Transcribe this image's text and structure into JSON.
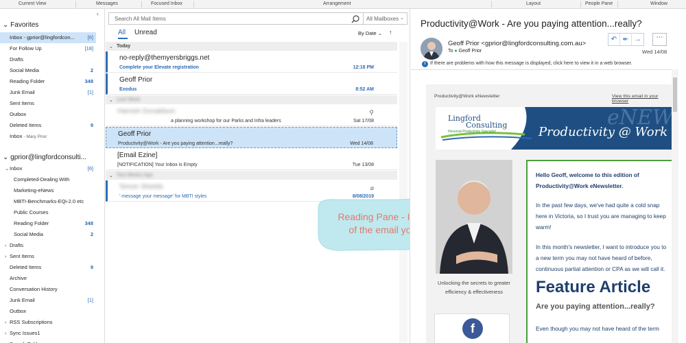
{
  "ribbon": {
    "groups": [
      "Current View",
      "Messages",
      "Focused Inbox",
      "Arrangement",
      "Layout",
      "People Pane",
      "Window"
    ]
  },
  "folders": {
    "favorites_title": "Favorites",
    "favorites": [
      {
        "label": "Inbox - gprior@lingfordcon...",
        "count": "[6]",
        "selected": true
      },
      {
        "label": "For Follow Up",
        "count": "[18]"
      },
      {
        "label": "Drafts",
        "count": ""
      },
      {
        "label": "Social Media",
        "count": "2"
      },
      {
        "label": "Reading Folder",
        "count": "348"
      },
      {
        "label": "Junk Email",
        "count": "[1]"
      },
      {
        "label": "Sent Items",
        "count": ""
      },
      {
        "label": "Outbox",
        "count": ""
      },
      {
        "label": "Deleted Items",
        "count": "9"
      },
      {
        "label": "Inbox",
        "sub": "- Mary Prior",
        "count": ""
      }
    ],
    "account_title": "gprior@lingfordconsulti...",
    "account": [
      {
        "label": "Inbox",
        "count": "[6]",
        "arrow": "⌄",
        "indent": 0
      },
      {
        "label": "Completed-Dealing With",
        "count": "",
        "indent": 1
      },
      {
        "label": "Marketing-eNews",
        "count": "",
        "indent": 1
      },
      {
        "label": "MBTI-Benchmarks-EQi-2.0 etc",
        "count": "",
        "indent": 1
      },
      {
        "label": "Public Courses",
        "count": "",
        "indent": 1
      },
      {
        "label": "Reading Folder",
        "count": "348",
        "indent": 1
      },
      {
        "label": "Social Media",
        "count": "2",
        "indent": 1
      },
      {
        "label": "Drafts",
        "count": "",
        "arrow": "›",
        "indent": 0
      },
      {
        "label": "Sent Items",
        "count": "",
        "arrow": "›",
        "indent": 0
      },
      {
        "label": "Deleted Items",
        "count": "9",
        "indent": 0
      },
      {
        "label": "Archive",
        "count": "",
        "indent": 0
      },
      {
        "label": "Conversation History",
        "count": "",
        "indent": 0
      },
      {
        "label": "Junk Email",
        "count": "[1]",
        "indent": 0
      },
      {
        "label": "Outbox",
        "count": "",
        "indent": 0
      },
      {
        "label": "RSS Subscriptions",
        "count": "",
        "arrow": "›",
        "indent": 0
      },
      {
        "label": "Sync Issues1",
        "count": "",
        "arrow": "›",
        "indent": 0
      },
      {
        "label": "Search Folders",
        "count": "",
        "indent": 0
      }
    ]
  },
  "list": {
    "search_placeholder": "Search All Mail Items",
    "scope": "All Mailboxes",
    "tab_all": "All",
    "tab_unread": "Unread",
    "sort": "By Date ⌄",
    "sort_dir": "↑",
    "groups": {
      "today": "Today",
      "last_week": "Last Week",
      "two_weeks": "Two Weeks Ago"
    },
    "messages": [
      {
        "from": "no-reply@themyersbriggs.net",
        "subject": "Complete your Elevate registration",
        "date": "12:18 PM"
      },
      {
        "from": "Geoff Prior",
        "subject": "Exodus",
        "date": "8:52 AM"
      },
      {
        "from": "Hamish Donaldson",
        "subject": "a planning workshop for our Parks and Infra leaders",
        "date": "Sat 17/08"
      },
      {
        "from": "Geoff Prior",
        "subject": "Productivity@Work - Are you paying attention...really?",
        "date": "Wed 14/08"
      },
      {
        "from": "[Email Ezine]",
        "subject": "[NOTIFICATION] Your Inbox is Empty",
        "date": "Tue 13/08"
      },
      {
        "from": "Simon Shields",
        "subject": "' message your message' for MBTI styles",
        "date": "8/08/2019"
      }
    ]
  },
  "callout": {
    "line1": "Reading Pane - Instant view",
    "line2": "of the email you select."
  },
  "reading": {
    "title": "Productivity@Work - Are you paying attention...really?",
    "from": "Geoff Prior <gprior@lingfordconsulting.com.au>",
    "to_label": "To",
    "to": "Geoff Prior",
    "date": "Wed 14/08",
    "info": "If there are problems with how this message is displayed, click here to view it in a web browser.",
    "more": "⋯",
    "newsletter": {
      "header": "Productivity@Work eNewsletter",
      "view_link": "View this email in your browser",
      "logo_line1": "Lingford",
      "logo_line2": "Consulting",
      "logo_tag": "Personal Productivity Specialist",
      "banner_text": "Productivity @ Work",
      "banner_big": "eNEWS",
      "caption": "Unlocking the secrets to greater efficiency & effectiveness",
      "lines": [
        "Hello Geoff, welcome to this edition of",
        "Productivity@Work eNewsletter.",
        "In the past few days, we've had quite a cold snap",
        "here in Victoria, so I trust you are managing to keep",
        "warm!",
        "In this month's newsletter, I want to introduce you to",
        "a new term you may not have heard of before,",
        "continuous partial attention or CPA as we will call it."
      ],
      "feature": "Feature Article",
      "feature_sub": "Are you paying attention...really?",
      "last_line": "Even though you may not have heard of the term"
    }
  }
}
